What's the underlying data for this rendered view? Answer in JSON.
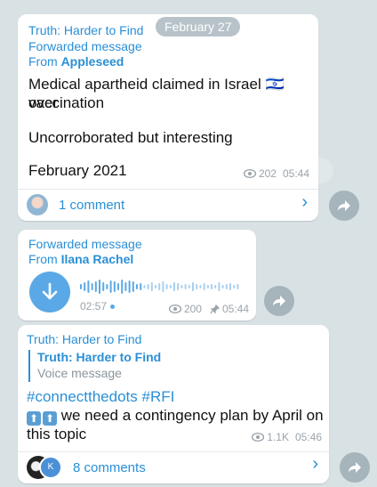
{
  "date_pill": "February 27",
  "msg1": {
    "channel": "Truth: Harder to Find",
    "forwarded": "Forwarded message",
    "from_prefix": "From ",
    "from_name": "Appleseed",
    "text_line1": "Medical apartheid claimed in Israel",
    "flag": "🇮🇱",
    "text_line1b": " over",
    "text_line2": "vaccination",
    "text_line3": "Uncorroborated but interesting",
    "text_line4": "February 2021",
    "views": "202",
    "time": "05:44",
    "comments": "1 comment"
  },
  "msg2": {
    "forwarded": "Forwarded message",
    "from_prefix": "From ",
    "from_name": "Ilana Rachel",
    "duration": "02:57",
    "views": "200",
    "time": "05:44"
  },
  "msg3": {
    "channel": "Truth: Harder to Find",
    "reply_channel": "Truth: Harder to Find",
    "reply_text": "Voice message",
    "hashtags": "#connectthedots #RFI",
    "text_line1": " we need a contingency plan by April on",
    "text_line2": "this topic",
    "views": "1.1K",
    "time": "05:46",
    "comments": "8 comments"
  },
  "colors": {
    "accent": "#2a8fd6",
    "meta": "#9aa4ab",
    "voice_button": "#5aa9e6",
    "share_button": "#a6b4bc"
  }
}
